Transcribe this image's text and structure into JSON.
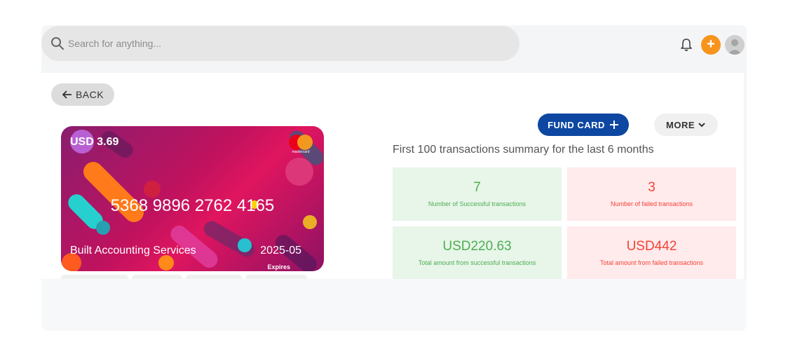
{
  "search": {
    "placeholder": "Search for anything..."
  },
  "header": {
    "add_label": "+"
  },
  "nav": {
    "back_label": "BACK"
  },
  "card": {
    "balance": "USD 3.69",
    "number": "5368 9896 2762 4165",
    "holder": "Built Accounting Services",
    "expiry": "2025-05",
    "expiry_label": "Expires",
    "brand": "mastercard"
  },
  "actions": {
    "fund_label": "FUND CARD",
    "more_label": "MORE"
  },
  "summary": {
    "title": "First 100 transactions summary for the last 6 months",
    "tiles": [
      {
        "value": "7",
        "label": "Number of Successful transactions",
        "status": "success"
      },
      {
        "value": "3",
        "label": "Number of failed transactions",
        "status": "failed"
      },
      {
        "value": "USD220.63",
        "label": "Total amount from successful transactions",
        "status": "success"
      },
      {
        "value": "USD442",
        "label": "Total amount from failed transactions",
        "status": "failed"
      }
    ]
  },
  "colors": {
    "accent": "#0d47a1",
    "orange": "#f7941d",
    "success": "#4caf50",
    "failed": "#f44336"
  },
  "icons": [
    "search-icon",
    "bell-icon",
    "plus-icon",
    "avatar-icon",
    "arrow-left-icon",
    "chevron-down-icon",
    "mastercard-logo"
  ]
}
